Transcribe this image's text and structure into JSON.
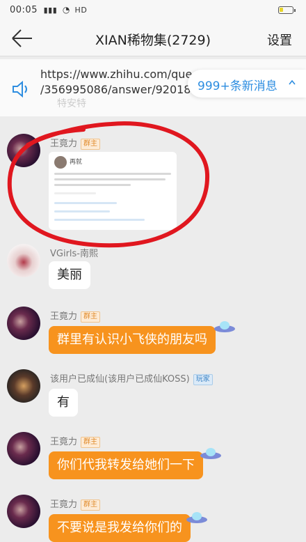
{
  "status_bar": {
    "time": "00:05",
    "signal": "ᴺᴵl",
    "network": "HD"
  },
  "colors": {
    "accent_orange": "#f7931e",
    "link_blue": "#2d8de0",
    "annotation_red": "#e0171f"
  },
  "nav": {
    "back_icon": "arrow-left-icon",
    "title": "XIAN稀物集(2729)",
    "settings_label": "设置"
  },
  "link_card": {
    "line1": "https://www.zhihu.com/que",
    "line2": "/356995086/answer/92018",
    "faded": "特安特"
  },
  "unread": {
    "label": "999+条新消息"
  },
  "messages": [
    {
      "sender": "王竟力",
      "badge": "群主",
      "kind": "image",
      "image_sender": "再就"
    },
    {
      "sender": "VGirls-南熙",
      "badge": "",
      "text": "美丽"
    },
    {
      "sender": "王竟力",
      "badge": "群主",
      "text": "群里有认识小飞侠的朋友吗"
    },
    {
      "sender": "该用户已成仙(该用户已成仙KOSS)",
      "badge": "玩家",
      "text": "有"
    },
    {
      "sender": "王竟力",
      "badge": "群主",
      "text": "你们代我转发给她们一下"
    },
    {
      "sender": "王竟力",
      "badge": "群主",
      "text": "不要说是我发给你们的"
    }
  ],
  "battery_level": 0.3
}
